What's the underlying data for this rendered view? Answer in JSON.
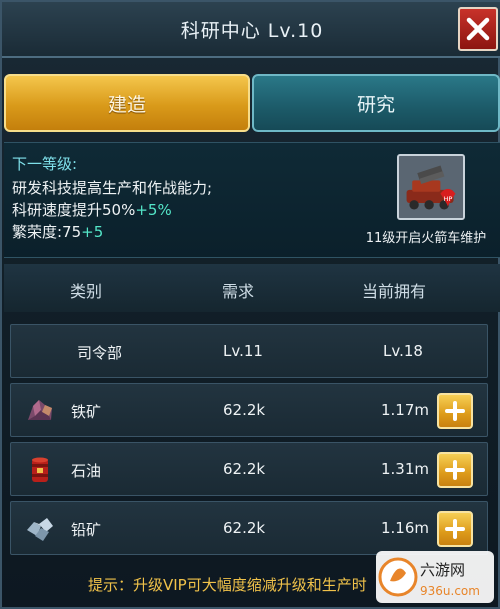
{
  "window": {
    "title": "科研中心 Lv.10"
  },
  "tabs": [
    {
      "label": "建造",
      "active": true
    },
    {
      "label": "研究",
      "active": false
    }
  ],
  "info": {
    "next_level_label": "下一等级:",
    "line1": "研发科技提高生产和作战能力;",
    "line2_prefix": "科研速度提升50%",
    "line2_bonus": "+5%",
    "line3_prefix": "繁荣度:75",
    "line3_bonus": "+5",
    "unlock_caption": "11级开启火箭车维护"
  },
  "table": {
    "headers": {
      "category": "类别",
      "required": "需求",
      "owned": "当前拥有"
    },
    "rows": [
      {
        "name": "司令部",
        "required": "Lv.11",
        "owned": "Lv.18",
        "icon": null
      },
      {
        "name": "铁矿",
        "required": "62.2k",
        "owned": "1.17m",
        "icon": "iron-ore-icon"
      },
      {
        "name": "石油",
        "required": "62.2k",
        "owned": "1.31m",
        "icon": "oil-barrel-icon"
      },
      {
        "name": "铅矿",
        "required": "62.2k",
        "owned": "1.16m",
        "icon": "lead-ore-icon"
      }
    ]
  },
  "tip": "提示：升级VIP可大幅度缩减升级和生产时",
  "watermark": {
    "name": "六游网",
    "domain": "936u.com"
  },
  "colors": {
    "accent_gold": "#e0a020",
    "accent_teal": "#1c5a68",
    "bonus_green": "#54e6c8",
    "tip_yellow": "#f0c24a",
    "close_red": "#b02820"
  }
}
